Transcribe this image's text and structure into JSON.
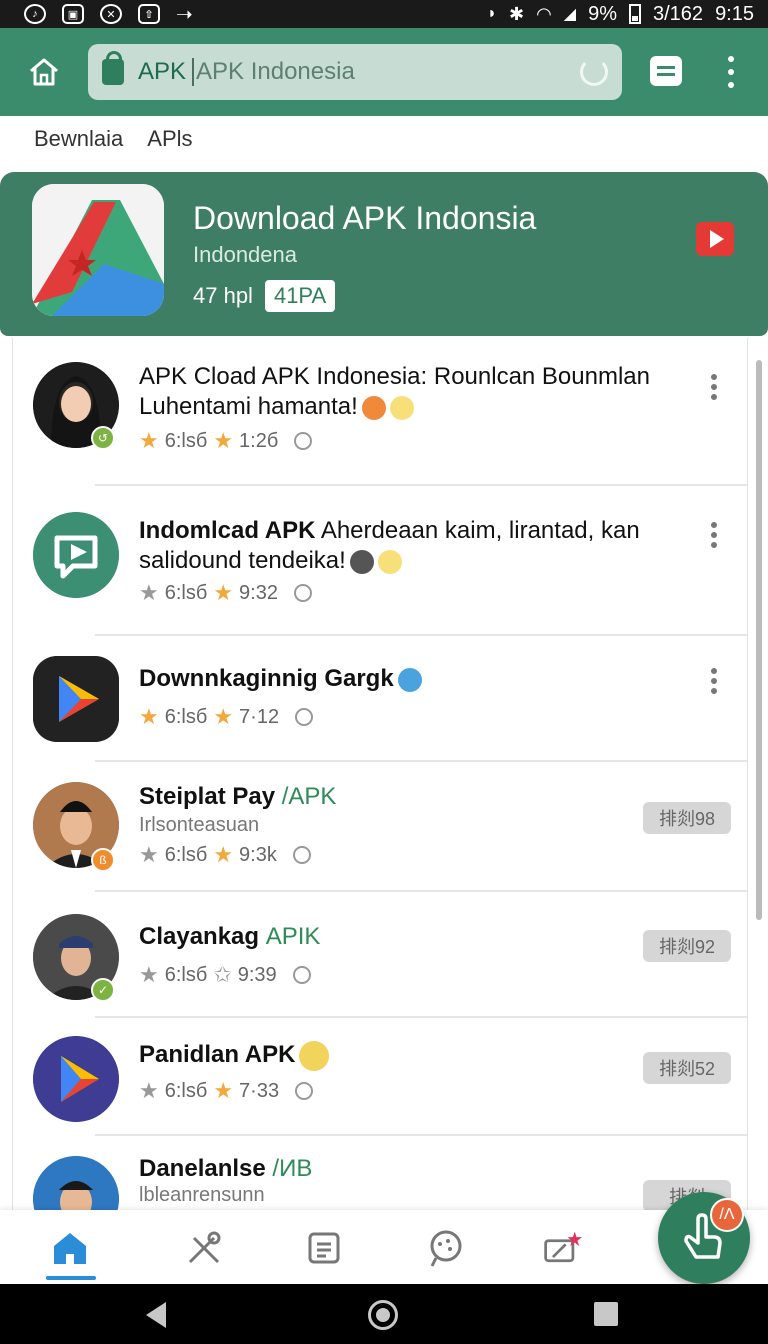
{
  "status_bar": {
    "battery": "9%",
    "time": "9:15",
    "extra": "3/162"
  },
  "browser": {
    "url_prefix": "APK",
    "url_text": "APK Indonesia"
  },
  "breadcrumb": {
    "first": "Bewnlaia",
    "second": "APls"
  },
  "banner": {
    "title": "Download APK Indonsia",
    "subtitle": "Indondena",
    "count_label": "47 hpl",
    "badge": "41PA"
  },
  "list": [
    {
      "title": "APK Cload APK Indonesia: Rounlcan Bounmlan Luhentami hamanta!",
      "rating1": "6:lsб",
      "rating2": "1:2б",
      "action": "more"
    },
    {
      "title_bold": "Indomlcad APK",
      "title": "Aherdeaan kaim, lirantad, kan salidound tendeika!",
      "rating1": "6:lsб",
      "rating2": "9:32"
    },
    {
      "title": "Downnkaginnig Gargk",
      "rating1": "6:lsб",
      "rating2": "7·12"
    },
    {
      "title": "Steiplat Pay",
      "title_accent": "/APK",
      "subtitle": "Irlsonteasuan",
      "rating1": "6:lsб",
      "rating2": "9:3k",
      "pill": "排剡98"
    },
    {
      "title": "Clayankag",
      "title_accent": "APIK",
      "rating1": "6:lsб",
      "rating2": "9:39",
      "pill": "排剡92"
    },
    {
      "title": "Panidlan APK",
      "rating1": "6:lsб",
      "rating2": "7·33",
      "pill": "排剡52"
    },
    {
      "title": "Danelanlse",
      "title_accent": "/ИB",
      "subtitle": "lbleanrensunn",
      "pill": "排剡"
    }
  ],
  "fab": {
    "badge": "/Λ"
  },
  "colors": {
    "primary": "#3a8c6c",
    "accent_star": "#f2a93b",
    "active_nav": "#2b8dd8"
  }
}
